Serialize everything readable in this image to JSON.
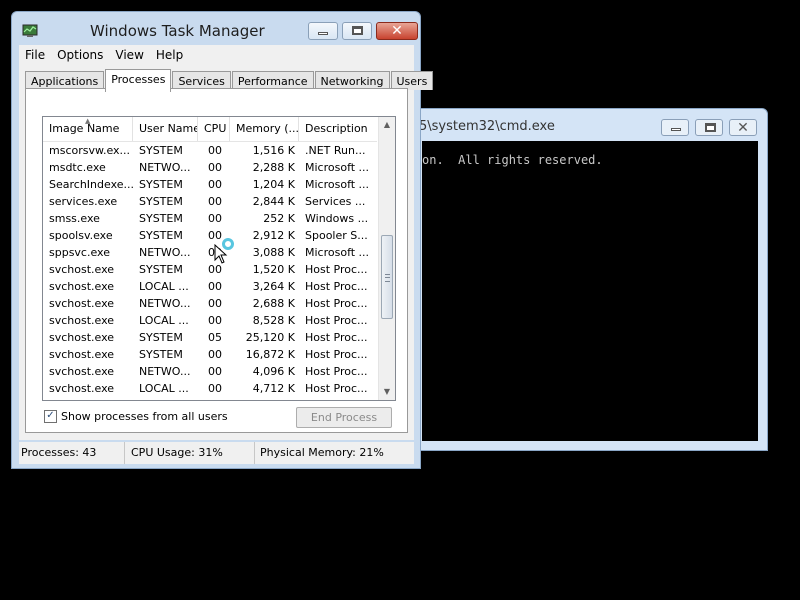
{
  "cmd": {
    "title": "5\\system32\\cmd.exe",
    "console_line": "on.  All rights reserved."
  },
  "taskmanager": {
    "title": "Windows Task Manager",
    "menu": [
      "File",
      "Options",
      "View",
      "Help"
    ],
    "tabs": [
      "Applications",
      "Processes",
      "Services",
      "Performance",
      "Networking",
      "Users"
    ],
    "active_tab": "Processes",
    "columns": [
      "Image Name",
      "User Name",
      "CPU",
      "Memory (...",
      "Description"
    ],
    "rows": [
      [
        "mscorsvw.ex...",
        "SYSTEM",
        "00",
        "1,516 K",
        ".NET Run..."
      ],
      [
        "msdtc.exe",
        "NETWO...",
        "00",
        "2,288 K",
        "Microsoft ..."
      ],
      [
        "SearchIndexe...",
        "SYSTEM",
        "00",
        "1,204 K",
        "Microsoft ..."
      ],
      [
        "services.exe",
        "SYSTEM",
        "00",
        "2,844 K",
        "Services ..."
      ],
      [
        "smss.exe",
        "SYSTEM",
        "00",
        "252 K",
        "Windows ..."
      ],
      [
        "spoolsv.exe",
        "SYSTEM",
        "00",
        "2,912 K",
        "Spooler S..."
      ],
      [
        "sppsvc.exe",
        "NETWO...",
        "00",
        "3,088 K",
        "Microsoft ..."
      ],
      [
        "svchost.exe",
        "SYSTEM",
        "00",
        "1,520 K",
        "Host Proc..."
      ],
      [
        "svchost.exe",
        "LOCAL ...",
        "00",
        "3,264 K",
        "Host Proc..."
      ],
      [
        "svchost.exe",
        "NETWO...",
        "00",
        "2,688 K",
        "Host Proc..."
      ],
      [
        "svchost.exe",
        "LOCAL ...",
        "00",
        "8,528 K",
        "Host Proc..."
      ],
      [
        "svchost.exe",
        "SYSTEM",
        "05",
        "25,120 K",
        "Host Proc..."
      ],
      [
        "svchost.exe",
        "SYSTEM",
        "00",
        "16,872 K",
        "Host Proc..."
      ],
      [
        "svchost.exe",
        "NETWO...",
        "00",
        "4,096 K",
        "Host Proc..."
      ],
      [
        "svchost.exe",
        "LOCAL ...",
        "00",
        "4,712 K",
        "Host Proc..."
      ]
    ],
    "show_all_label": "Show processes from all users",
    "show_all_checked": true,
    "end_process_label": "End Process",
    "status": {
      "processes": "Processes: 43",
      "cpu": "CPU Usage: 31%",
      "memory": "Physical Memory: 21%"
    }
  },
  "icons": {
    "minimize": "minimize-icon",
    "maximize": "maximize-icon",
    "close": "close-icon",
    "app": "task-manager-icon",
    "check": "checkmark-icon",
    "cursor": "busy-cursor-icon"
  }
}
